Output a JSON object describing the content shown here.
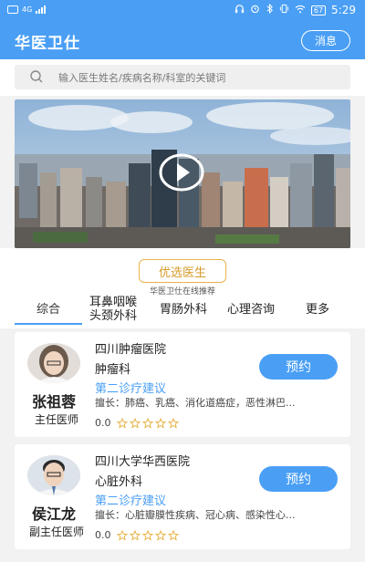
{
  "status_bar": {
    "carrier": "HD",
    "network": "4G",
    "battery": "67",
    "time": "5:29",
    "icons": [
      "headphones-icon",
      "alarm-icon",
      "bluetooth-icon",
      "vibrate-icon",
      "wifi-icon"
    ]
  },
  "navbar": {
    "title": "华医卫仕",
    "message_label": "消息"
  },
  "search": {
    "placeholder": "输入医生姓名/疾病名称/科室的关键词"
  },
  "banner": {
    "kind": "video",
    "play_icon": "play-icon"
  },
  "recommend": {
    "title": "优选医生",
    "subtitle": "华医卫仕在线推荐"
  },
  "tabs": [
    {
      "label": "综合",
      "active": true
    },
    {
      "label": "耳鼻咽喉\n头颈外科",
      "active": false
    },
    {
      "label": "胃肠外科",
      "active": false
    },
    {
      "label": "心理咨询",
      "active": false
    },
    {
      "label": "更多",
      "active": false
    }
  ],
  "doctors": [
    {
      "name": "张祖蓉",
      "title": "主任医师",
      "hospital": "四川肿瘤医院",
      "department": "肿瘤科",
      "advice": "第二诊疗建议",
      "skill": "擅长：肺癌、乳癌、消化道癌症，恶性淋巴...",
      "rating": "0.0",
      "stars": 5,
      "book_label": "预约"
    },
    {
      "name": "侯江龙",
      "title": "副主任医师",
      "hospital": "四川大学华西医院",
      "department": "心脏外科",
      "advice": "第二诊疗建议",
      "skill": "擅长：心脏瓣膜性疾病、冠心病、感染性心...",
      "rating": "0.0",
      "stars": 5,
      "book_label": "预约"
    }
  ],
  "colors": {
    "primary": "#4a9ff5",
    "accent_gold": "#e8b449",
    "star": "#e8b449"
  }
}
